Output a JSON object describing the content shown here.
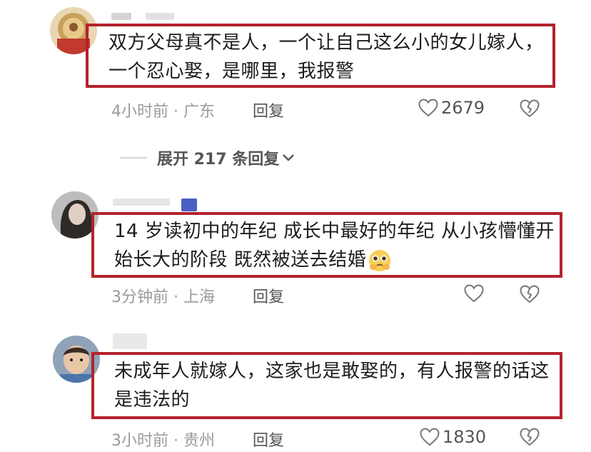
{
  "comments": [
    {
      "text": "双方父母真不是人，一个让自己这么小的女儿嫁人，一个忍心娶，是哪里，我报警",
      "time_location": "4小时前 · 广东",
      "reply_label": "回复",
      "likes": "2679"
    },
    {
      "text": "14 岁读初中的年纪 成长中最好的年纪 从小孩懵懂开始长大的阶段 既然被送去结婚",
      "emoji": "pleading-face-emoji",
      "time_location": "3分钟前 · 上海",
      "reply_label": "回复",
      "likes": ""
    },
    {
      "text": "未成年人就嫁人，这家也是敢娶的，有人报警的话这是违法的",
      "time_location": "3小时前 · 贵州",
      "reply_label": "回复",
      "likes": "1830"
    }
  ],
  "expand_replies": "展开 217 条回复",
  "colors": {
    "highlight_border": "#b3232b",
    "meta_text": "#9a9a9a"
  },
  "icons": [
    "heart-outline-icon",
    "dislike-heart-icon",
    "chevron-down-icon"
  ]
}
